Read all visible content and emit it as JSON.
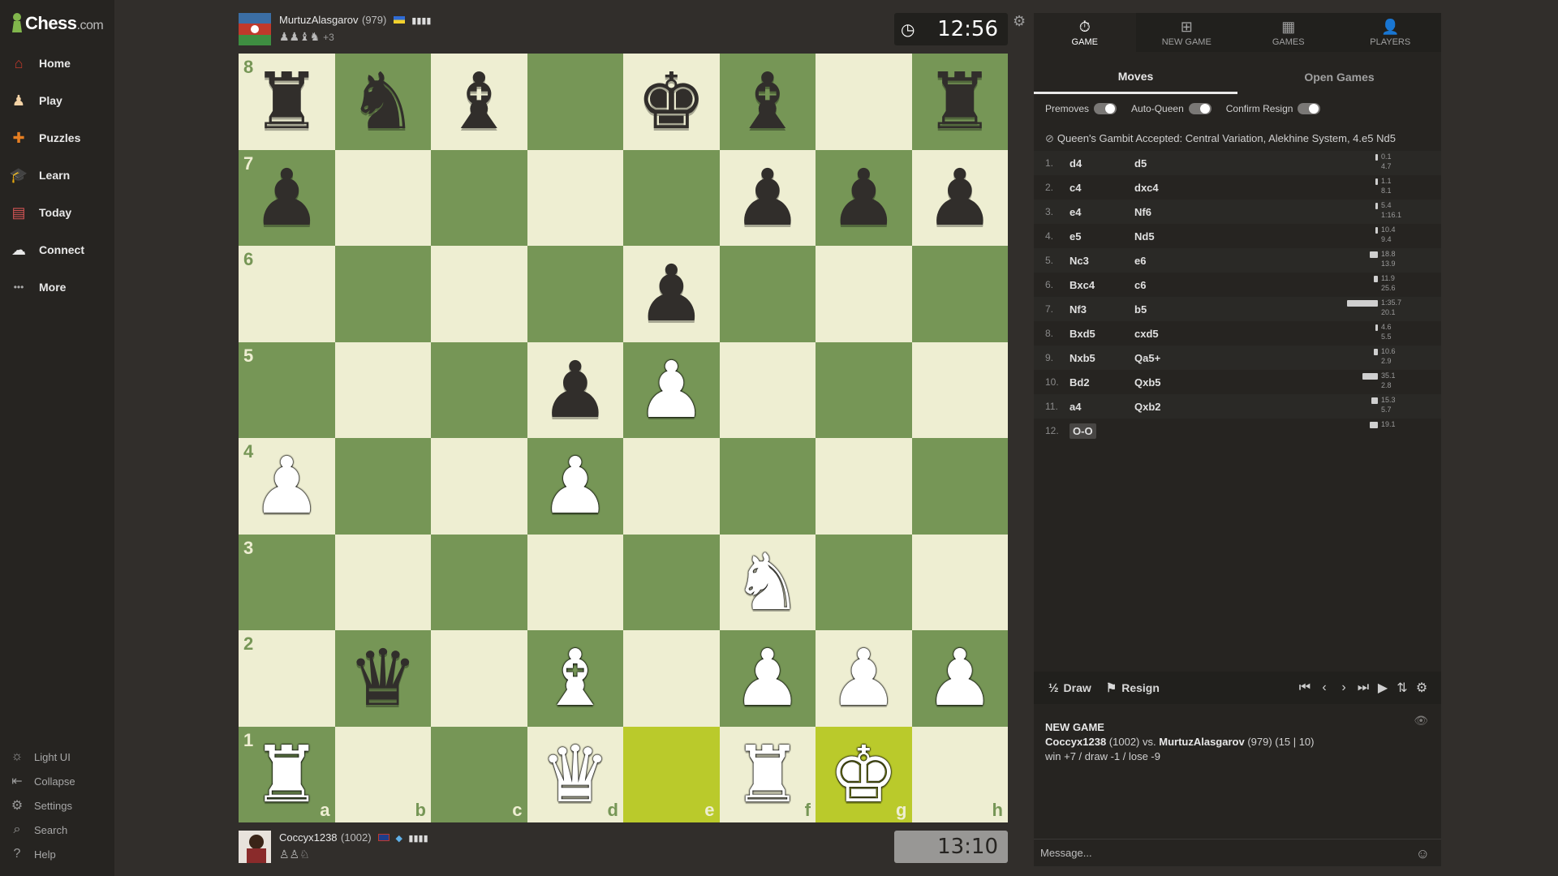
{
  "brand": {
    "name": "Chess",
    "suffix": ".com"
  },
  "sidebar": {
    "items": [
      {
        "label": "Home",
        "icon": "home-icon",
        "color": "#c0392b"
      },
      {
        "label": "Play",
        "icon": "play-icon",
        "color": "#f4d3a6"
      },
      {
        "label": "Puzzles",
        "icon": "puzzle-icon",
        "color": "#e67e22"
      },
      {
        "label": "Learn",
        "icon": "learn-icon",
        "color": "#3498db"
      },
      {
        "label": "Today",
        "icon": "today-icon",
        "color": "#d35454"
      },
      {
        "label": "Connect",
        "icon": "connect-icon",
        "color": "#e8e8e8"
      },
      {
        "label": "More",
        "icon": "more-icon",
        "color": "#aaaaaa"
      }
    ],
    "bottom": [
      {
        "label": "Light UI",
        "icon": "sun-icon"
      },
      {
        "label": "Collapse",
        "icon": "collapse-icon"
      },
      {
        "label": "Settings",
        "icon": "gear-icon"
      },
      {
        "label": "Search",
        "icon": "search-icon"
      },
      {
        "label": "Help",
        "icon": "help-icon"
      }
    ]
  },
  "top_player": {
    "name": "MurtuzAlasgarov",
    "rating": "(979)",
    "captured_extra": "+3",
    "flag": "flag-ua-icon"
  },
  "bottom_player": {
    "name": "Coccyx1238",
    "rating": "(1002)",
    "flag": "flag-gb-icon"
  },
  "clocks": {
    "top": "12:56",
    "bottom": "13:10"
  },
  "board": {
    "ranks": [
      "8",
      "7",
      "6",
      "5",
      "4",
      "3",
      "2",
      "1"
    ],
    "files": [
      "a",
      "b",
      "c",
      "d",
      "e",
      "f",
      "g",
      "h"
    ],
    "highlight": [
      "e1",
      "g1"
    ],
    "pieces": {
      "a8": "bR",
      "b8": "bN",
      "c8": "bB",
      "e8": "bK",
      "f8": "bB",
      "h8": "bR",
      "a7": "bP",
      "f7": "bP",
      "g7": "bP",
      "h7": "bP",
      "e6": "bP",
      "d5": "bP",
      "e5": "wP",
      "a4": "wP",
      "d4": "wP",
      "f3": "wN",
      "b2": "bQ",
      "d2": "wB",
      "f2": "wP",
      "g2": "wP",
      "h2": "wP",
      "a1": "wR",
      "d1": "wQ",
      "f1": "wR",
      "g1": "wK"
    },
    "colors": {
      "light": "#eeeed2",
      "dark": "#769656",
      "highlight": "#baca2b"
    }
  },
  "panel": {
    "top_tabs": [
      {
        "label": "GAME",
        "icon": "clock-icon"
      },
      {
        "label": "NEW GAME",
        "icon": "plus-icon"
      },
      {
        "label": "GAMES",
        "icon": "board-icon"
      },
      {
        "label": "PLAYERS",
        "icon": "players-icon"
      }
    ],
    "sub_tabs": [
      "Moves",
      "Open Games"
    ],
    "toggles": [
      "Premoves",
      "Auto-Queen",
      "Confirm Resign"
    ],
    "opening": "Queen's Gambit Accepted: Central Variation, Alekhine System, 4.e5 Nd5",
    "moves": [
      {
        "no": "1.",
        "w": "d4",
        "b": "d5",
        "tw": "0.1",
        "tb": "4.7",
        "bw": 0.02,
        "bb": 0.0
      },
      {
        "no": "2.",
        "w": "c4",
        "b": "dxc4",
        "tw": "1.1",
        "tb": "8.1",
        "bw": 0.02,
        "bb": 0.0
      },
      {
        "no": "3.",
        "w": "e4",
        "b": "Nf6",
        "tw": "5.4",
        "tb": "1:16.1",
        "bw": 0.06,
        "bb": 0.0
      },
      {
        "no": "4.",
        "w": "e5",
        "b": "Nd5",
        "tw": "10.4",
        "tb": "9.4",
        "bw": 0.09,
        "bb": 0.0
      },
      {
        "no": "5.",
        "w": "Nc3",
        "b": "e6",
        "tw": "18.8",
        "tb": "13.9",
        "bw": 0.27,
        "bb": 0.0
      },
      {
        "no": "6.",
        "w": "Bxc4",
        "b": "c6",
        "tw": "11.9",
        "tb": "25.6",
        "bw": 0.12,
        "bb": 0.0
      },
      {
        "no": "7.",
        "w": "Nf3",
        "b": "b5",
        "tw": "1:35.7",
        "tb": "20.1",
        "bw": 1.0,
        "bb": 0.0
      },
      {
        "no": "8.",
        "w": "Bxd5",
        "b": "cxd5",
        "tw": "4.6",
        "tb": "5.5",
        "bw": 0.04,
        "bb": 0.0
      },
      {
        "no": "9.",
        "w": "Nxb5",
        "b": "Qa5+",
        "tw": "10.6",
        "tb": "2.9",
        "bw": 0.12,
        "bb": 0.0
      },
      {
        "no": "10.",
        "w": "Bd2",
        "b": "Qxb5",
        "tw": "35.1",
        "tb": "2.8",
        "bw": 0.5,
        "bb": 0.0
      },
      {
        "no": "11.",
        "w": "a4",
        "b": "Qxb2",
        "tw": "15.3",
        "tb": "5.7",
        "bw": 0.2,
        "bb": 0.0
      },
      {
        "no": "12.",
        "w": "O-O",
        "b": "",
        "tw": "19.1",
        "tb": "",
        "bw": 0.27,
        "bb": 0.0
      }
    ],
    "controls": {
      "draw": "Draw",
      "resign": "Resign",
      "half": "½"
    },
    "newgame": {
      "title": "NEW GAME",
      "white": "Coccyx1238",
      "white_rating": "(1002)",
      "vs": "vs.",
      "black": "MurtuzAlasgarov",
      "black_rating": "(979) (15 | 10)",
      "result": "win +7 / draw -1 / lose -9"
    },
    "message_placeholder": "Message..."
  }
}
